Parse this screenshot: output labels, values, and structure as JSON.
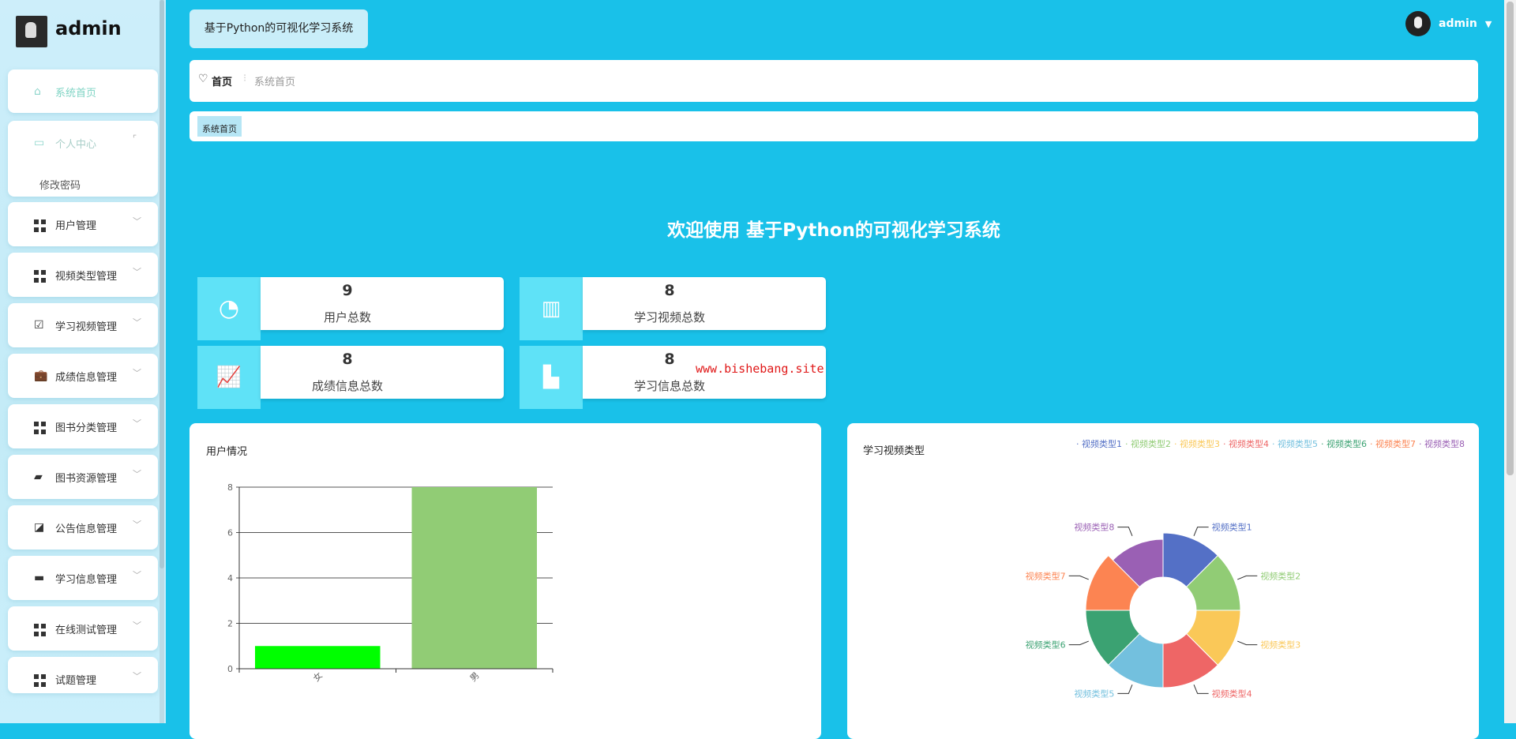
{
  "sidebar": {
    "brand": "admin",
    "items": [
      {
        "label": "系统首页",
        "icon": "home-icon"
      },
      {
        "label": "个人中心",
        "icon": "card-icon",
        "sub": [
          "修改密码"
        ]
      },
      {
        "label": "用户管理",
        "icon": "grid-icon"
      },
      {
        "label": "视频类型管理",
        "icon": "grid-icon"
      },
      {
        "label": "学习视频管理",
        "icon": "clipboard-check-icon"
      },
      {
        "label": "成绩信息管理",
        "icon": "briefcase-icon"
      },
      {
        "label": "图书分类管理",
        "icon": "grid-icon"
      },
      {
        "label": "图书资源管理",
        "icon": "wallet-icon"
      },
      {
        "label": "公告信息管理",
        "icon": "chart-line-icon"
      },
      {
        "label": "学习信息管理",
        "icon": "store-icon"
      },
      {
        "label": "在线测试管理",
        "icon": "grid-icon"
      },
      {
        "label": "试题管理",
        "icon": "grid-icon"
      }
    ]
  },
  "header": {
    "system_title": "基于Python的可视化学习系统",
    "user": "admin"
  },
  "breadcrumb": {
    "home": "首页",
    "current": "系统首页"
  },
  "tags": [
    "系统首页"
  ],
  "welcome": "欢迎使用 基于Python的可视化学习系统",
  "stats": [
    {
      "value": "9",
      "label": "用户总数"
    },
    {
      "value": "8",
      "label": "学习视频总数"
    },
    {
      "value": "8",
      "label": "成绩信息总数"
    },
    {
      "value": "8",
      "label": "学习信息总数"
    }
  ],
  "watermark": "www.bishebang.site",
  "chart_data": [
    {
      "type": "bar",
      "title": "用户情况",
      "categories": [
        "女",
        "男"
      ],
      "values": [
        1,
        8
      ],
      "colors": [
        "#00ff00",
        "#91cc75"
      ],
      "ylim": [
        0,
        8
      ],
      "yticks": [
        "0",
        "2",
        "4",
        "6",
        "8"
      ]
    },
    {
      "type": "pie",
      "title": "学习视频类型",
      "categories": [
        "视频类型1",
        "视频类型2",
        "视频类型3",
        "视频类型4",
        "视频类型5",
        "视频类型6",
        "视频类型7",
        "视频类型8"
      ],
      "values": [
        1,
        1,
        1,
        1,
        1,
        1,
        1,
        1
      ],
      "colors": [
        "#5470c6",
        "#91cc75",
        "#fac858",
        "#ee6666",
        "#73c0de",
        "#3ba272",
        "#fc8452",
        "#9a60b4"
      ],
      "legend": "top-right"
    }
  ]
}
